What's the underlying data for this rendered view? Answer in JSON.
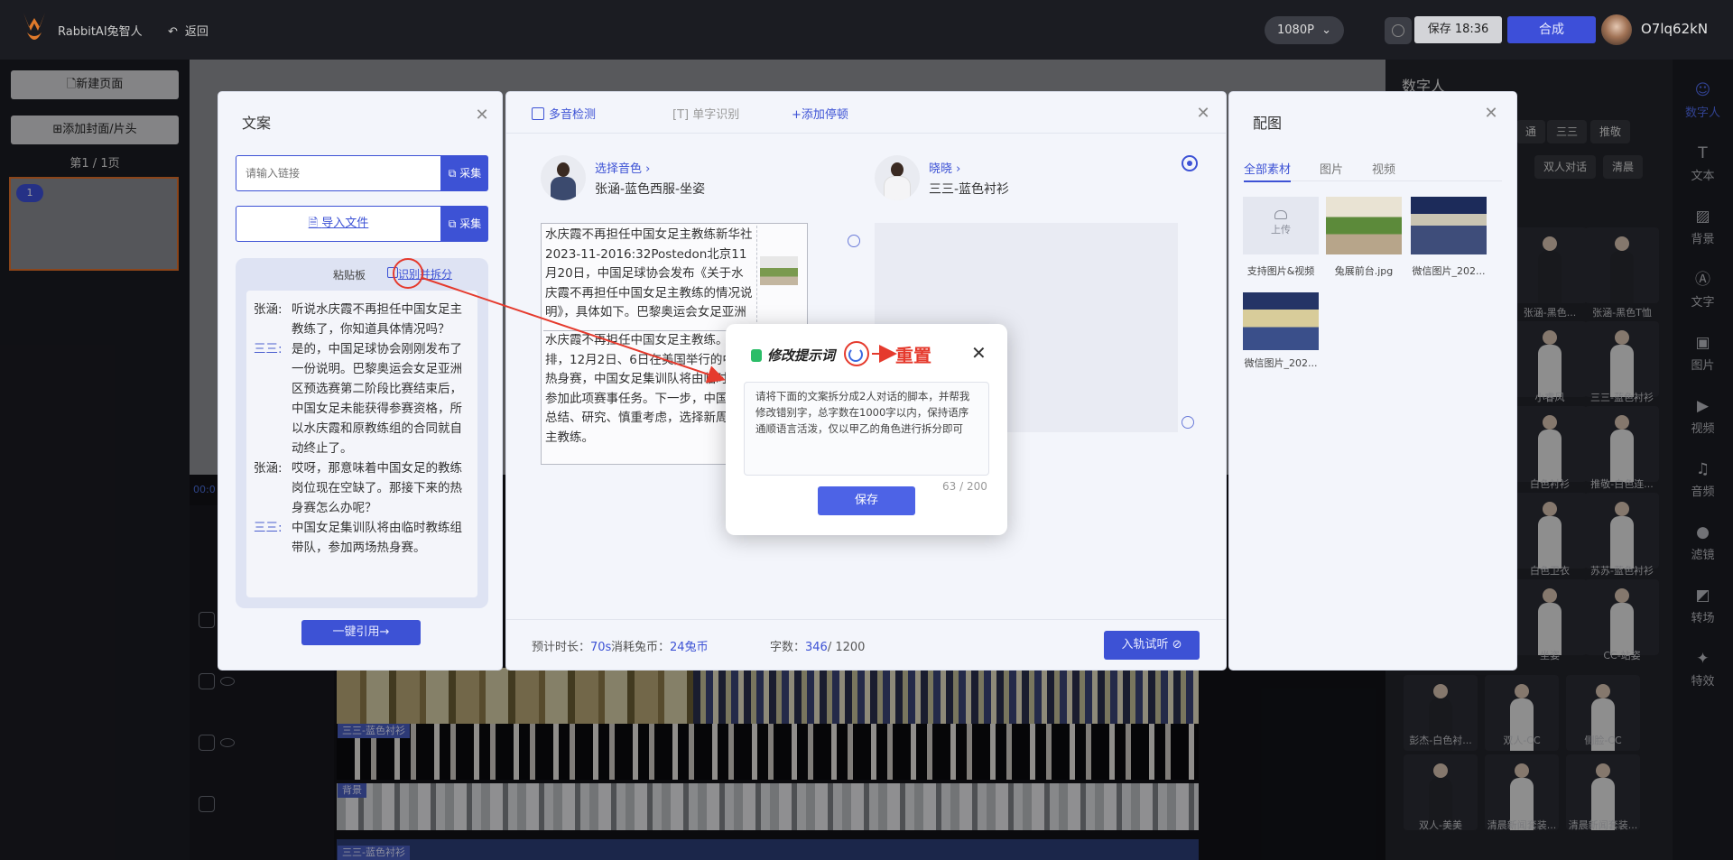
{
  "topbar": {
    "app_name": "RabbitAI兔智人",
    "back_label": "返回",
    "resolution": "1080P",
    "save_label": "保存 18:36",
    "compose_label": "合成",
    "username": "O7lq62kN"
  },
  "left": {
    "new_page": "新建页面",
    "add_cover": "添加封面/片头",
    "page_indicator": "第1 / 1页",
    "page_number": "1"
  },
  "timeline": {
    "time": "00:0",
    "track_labels": [
      "三三-蓝色衬衫",
      "背景",
      "三三-蓝色衬衫"
    ]
  },
  "gallery": {
    "title": "数字人",
    "tags": [
      "通",
      "三三",
      "推敬",
      "双人对话",
      "清晨"
    ],
    "items": [
      "张涵-黑色...",
      "张涵-黑色T恤",
      "小睿风",
      "三三-蓝色衬衫",
      "白色衬衫",
      "推敬-白色连...",
      "白色卫衣",
      "苏苏-蓝色衬衫",
      "坐姿",
      "CC-站姿",
      "彭杰-白色衬...",
      "双人-CC",
      "侧脸-CC",
      "双人-美美",
      "清晨新闻套装...",
      "清晨新闻套装..."
    ]
  },
  "tools": [
    "数字人",
    "文本",
    "背景",
    "文字",
    "图片",
    "视频",
    "音频",
    "滤镜",
    "转场",
    "特效"
  ],
  "wenan": {
    "title": "文案",
    "link_placeholder": "请输入链接",
    "collect_label": "采集",
    "import_label": "导入文件",
    "clipboard_title": "粘贴板",
    "split_label": "识别并拆分",
    "dialog": [
      {
        "speaker": "张涵:",
        "text": "听说水庆霞不再担任中国女足主教练了，你知道具体情况吗？",
        "style": "a"
      },
      {
        "speaker": "三三:",
        "text": "是的，中国足球协会刚刚发布了一份说明。巴黎奥运会女足亚洲区预选赛第二阶段比赛结束后，中国女足未能获得参赛资格，所以水庆霞和原教练组的合同就自动终止了。",
        "style": "b"
      },
      {
        "speaker": "张涵:",
        "text": "哎呀，那意味着中国女足的教练岗位现在空缺了。那接下来的热身赛怎么办呢？",
        "style": "a"
      },
      {
        "speaker": "三三:",
        "text": "中国女足集训队将由临时教练组带队，参加两场热身赛。",
        "style": "b"
      }
    ],
    "quote_label": "一键引用→"
  },
  "script": {
    "toolbar": [
      "多音检测",
      "单字识别",
      "+添加停顿"
    ],
    "voice_left": {
      "select": "选择音色 ›",
      "name": "张涵-蓝色西服-坐姿"
    },
    "voice_right": {
      "select": "晓晓 ›",
      "name": "三三-蓝色衬衫"
    },
    "text_block_1": "水庆霞不再担任中国女足主教练新华社2023-11-2016:32Postedon北京11月20日，中国足球协会发布《关于水庆霞不再担任中国女足主教练的情况说明》，具体如下。巴黎奥运会女足亚洲区预选赛第二阶段比赛结束后，由于中",
    "text_block_2": "水庆霞不再担任中国女足主教练。根据工作安排，12月2日、6日在美国举行的中美女足两场热身赛，中国女足集训队将由临时教练组带队参加此项赛事任务。下一步，中国足协将认真总结、研究、慎重考虑，选择新周期中国女足主教练。",
    "footer": {
      "duration_label": "预计时长：",
      "duration_value": "70s",
      "coins_label": "消耗兔币：",
      "coins_value": "24",
      "coins_unit": "兔币",
      "words_label": "字数：",
      "words_value": "346",
      "words_max": "/ 1200",
      "audition_label": "入轨试听 ⊘"
    }
  },
  "peitu": {
    "title": "配图",
    "tabs": [
      "全部素材",
      "图片",
      "视频"
    ],
    "upload_label": "上传",
    "items": [
      "支持图片&视频",
      "兔展前台.jpg",
      "微信图片_202...",
      "微信图片_202..."
    ]
  },
  "modal": {
    "title": "修改提示词",
    "prompt": "请将下面的文案拆分成2人对话的脚本，并帮我修改错别字，总字数在1000字以内，保持语序通顺语言活泼，仅以甲乙的角色进行拆分即可",
    "counter": "63 / 200",
    "save_label": "保存"
  },
  "annotation": {
    "reset_label": "重置",
    "color": "#e53a2d"
  }
}
